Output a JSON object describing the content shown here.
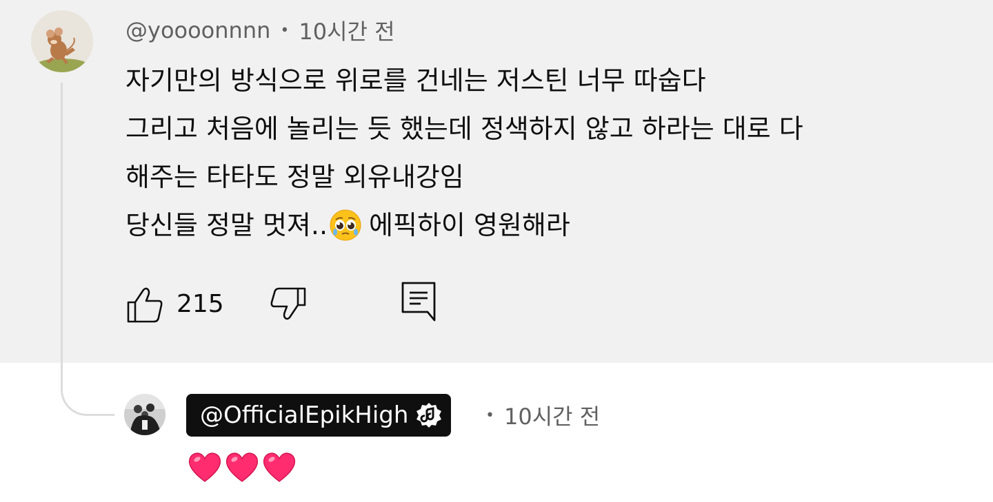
{
  "comment": {
    "author": "@yoooonnnn",
    "time": "10시간 전",
    "lines": [
      "자기만의 방식으로 위로를 건네는 저스틴 너무 따숩다",
      "그리고 처음에 놀리는 듯 했는데 정색하지 않고 하라는 대로 다",
      "해주는 타타도 정말 외유내강임",
      "당신들 정말 멋져.."
    ],
    "line4_after_emoji": "에픽하이 영원해라",
    "like_count": "215",
    "emoji": "pleading-face"
  },
  "reply": {
    "author": "@OfficialEpikHigh",
    "time": "10시간 전",
    "hearts": 3,
    "badge_icon": "music-note-badge-icon"
  },
  "colors": {
    "comment_background": "#f1f1f1",
    "meta_text": "#606060",
    "primary_text": "#0f0f0f",
    "author_badge_bg": "#0f0f0f",
    "heart": "#ff2d6f"
  }
}
